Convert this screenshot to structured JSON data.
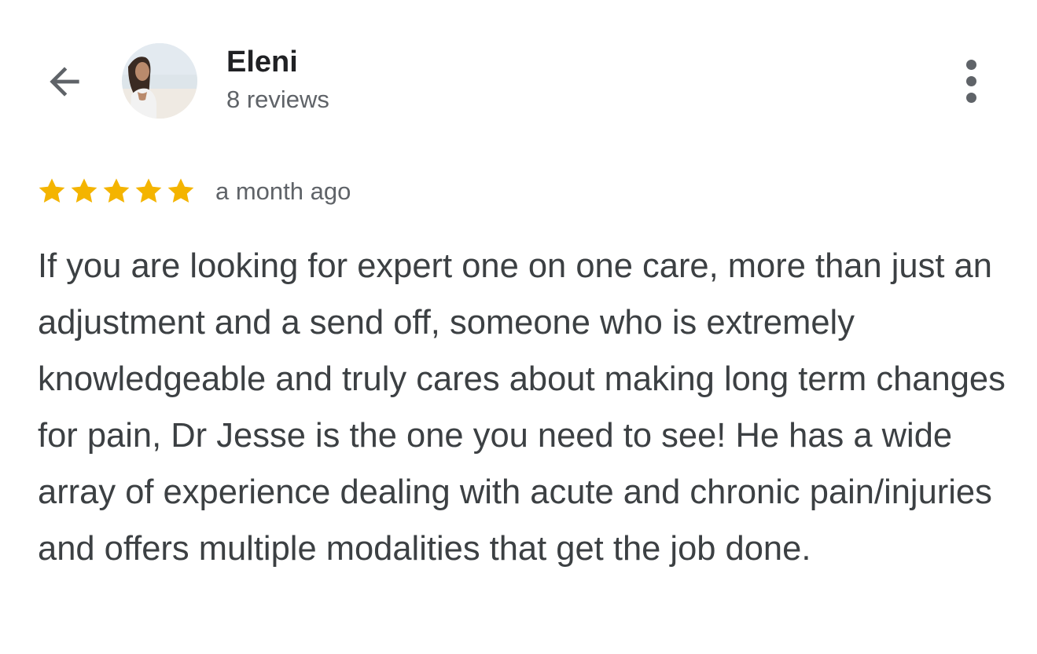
{
  "header": {
    "back_icon": "arrow-left-icon",
    "user_name": "Eleni",
    "review_count": "8 reviews",
    "more_icon": "more-vertical-icon"
  },
  "review": {
    "rating": 5,
    "rating_max": 5,
    "star_color": "#f4b400",
    "time": "a month ago",
    "text": "If you are looking for expert one on one care, more than just an adjustment and a send off, someone who is extremely knowledgeable and truly cares about making long term changes for pain, Dr Jesse is the one you need to see! He has a wide array of experience dealing with acute and chronic pain/injuries and offers multiple modalities that get the job done."
  }
}
